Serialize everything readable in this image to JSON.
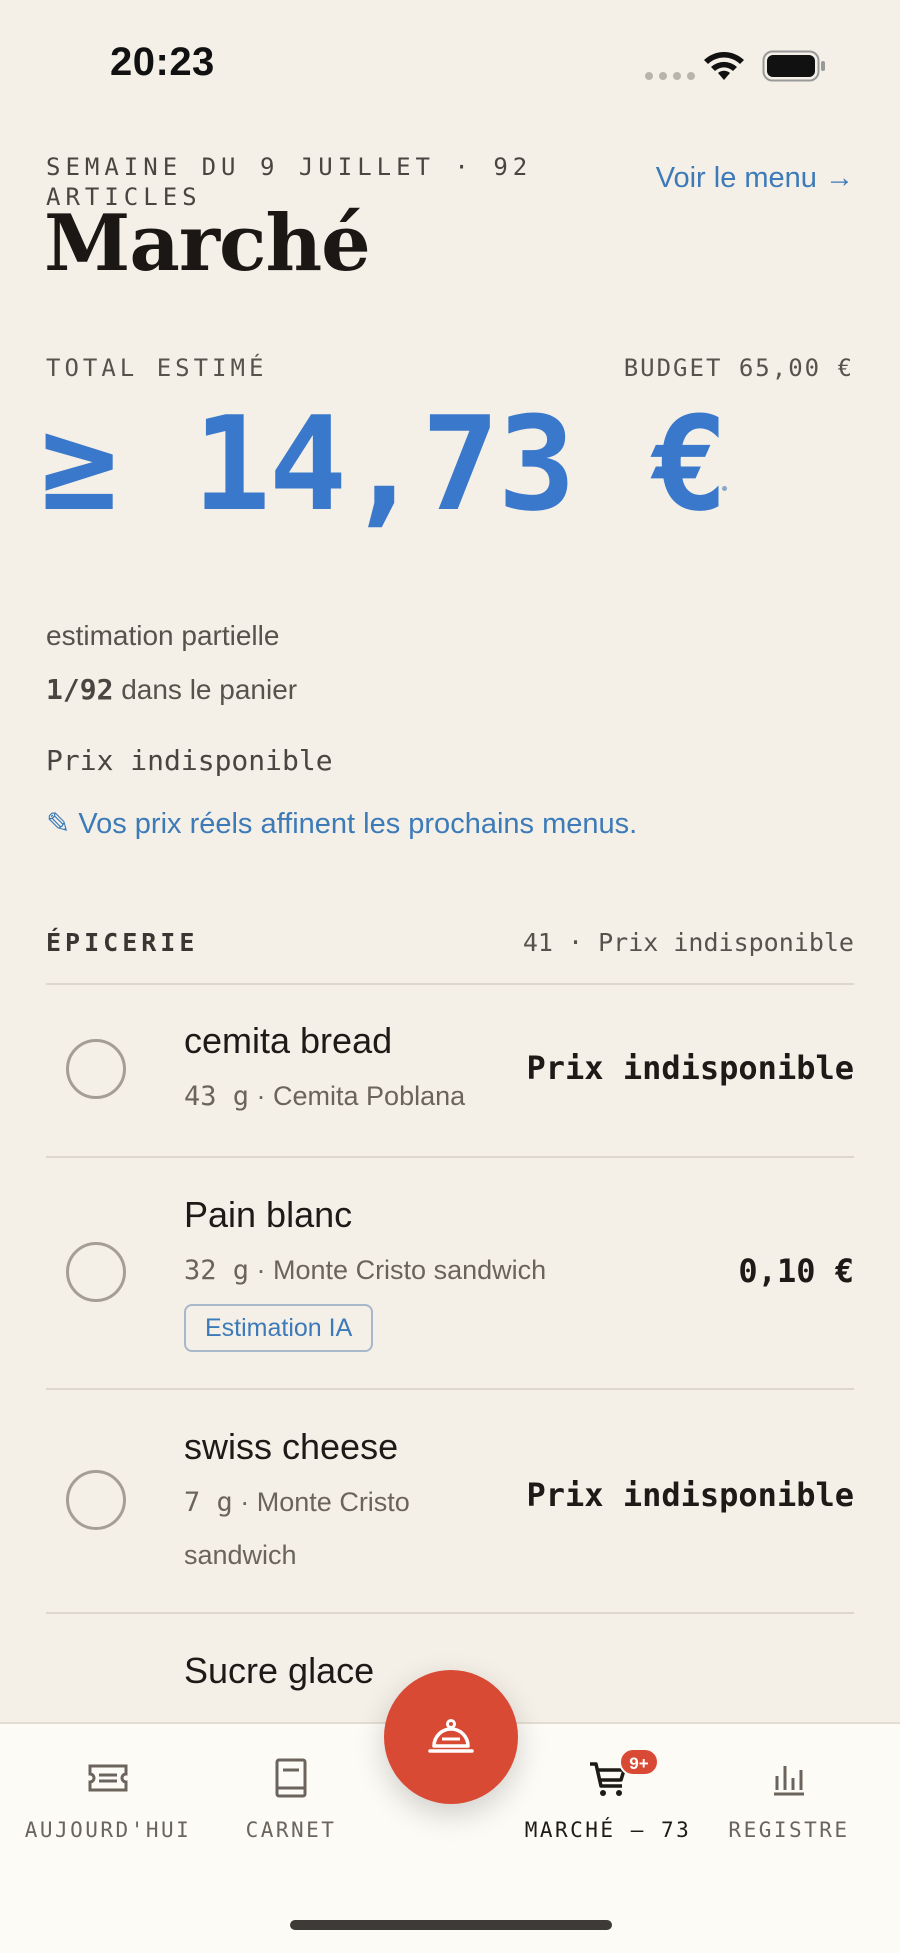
{
  "status_bar": {
    "time": "20:23"
  },
  "header": {
    "kicker": "SEMAINE DU 9 JUILLET · 92 ARTICLES",
    "title": "Marché",
    "menu_link": "Voir le menu →"
  },
  "total": {
    "label": "TOTAL ESTIMÉ",
    "budget": "BUDGET 65,00 €",
    "value": "≥ 14,73 €",
    "partial_note": "estimation partielle",
    "cart_count_strong": "1/92",
    "cart_count_rest": " dans le panier",
    "price_note": "Prix indisponible",
    "hint": "✎ Vos prix réels affinent les prochains menus."
  },
  "section": {
    "title": "ÉPICERIE",
    "meta": "41 · Prix indisponible"
  },
  "items": [
    {
      "name": "cemita bread",
      "qty": "43  g",
      "recipe": " · Cemita Poblana",
      "price": "Prix indisponible"
    },
    {
      "name": "Pain blanc",
      "qty": "32  g",
      "recipe": " · Monte Cristo sandwich",
      "price": "0,10 €",
      "badge": "Estimation IA"
    },
    {
      "name": "swiss cheese",
      "qty": "7  g",
      "recipe": " · Monte Cristo sandwich",
      "price": "Prix indisponible"
    }
  ],
  "peek_item": "Sucre glace",
  "nav": {
    "today": "AUJOURD'HUI",
    "notebook": "CARNET",
    "market": "MARCHÉ — 73",
    "market_badge": "9+",
    "register": "REGISTRE"
  },
  "colors": {
    "accent_blue": "#3a78cb",
    "accent_red": "#d94a35",
    "background": "#f4f0e8"
  }
}
